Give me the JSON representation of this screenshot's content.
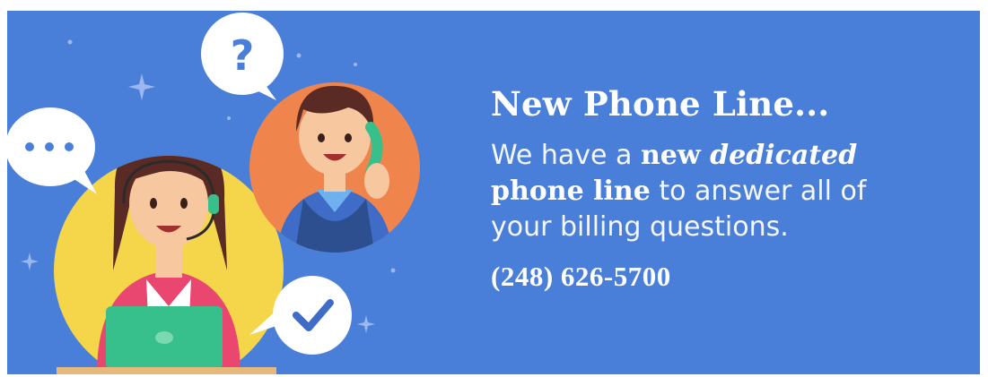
{
  "banner": {
    "headline": "New Phone Line...",
    "body": {
      "intro": "We have a ",
      "bold": "new ",
      "bold_italic": "dedicated",
      "bold2": "phone line",
      "rest1": " to answer all of",
      "rest2": "your billing questions."
    },
    "phone_number": "(248) 626-5700",
    "colors": {
      "background": "#4a7fd9",
      "text": "#ffffff",
      "agent_circle": "#f5d54a",
      "caller_circle": "#f0844d",
      "laptop": "#37c08b"
    },
    "icons": [
      "question-bubble-icon",
      "ellipsis-bubble-icon",
      "checkmark-bubble-icon",
      "sparkle-icon"
    ]
  }
}
